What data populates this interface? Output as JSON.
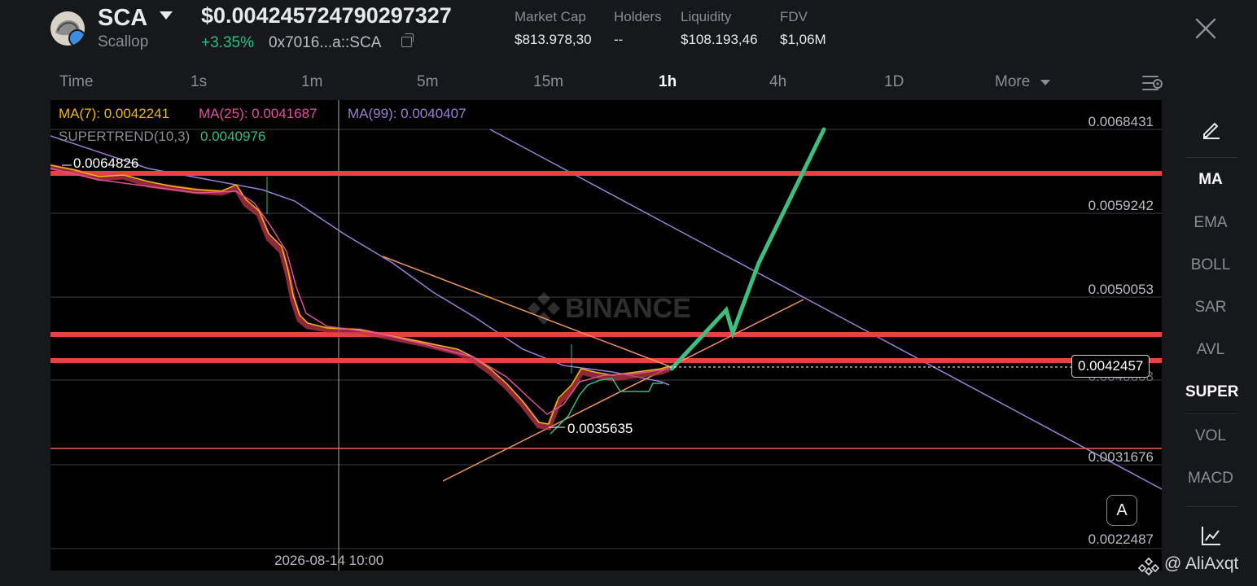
{
  "header": {
    "symbol": "SCA",
    "name": "Scallop",
    "price": "$0.004245724790297327",
    "change": "+3.35%",
    "address": "0x7016...a::SCA",
    "stats": [
      {
        "label": "Market Cap",
        "value": "$813.978,30"
      },
      {
        "label": "Holders",
        "value": "--"
      },
      {
        "label": "Liquidity",
        "value": "$108.193,46"
      },
      {
        "label": "FDV",
        "value": "$1,06M"
      }
    ],
    "close_icon": "close-icon",
    "copy_icon": "copy-icon"
  },
  "intervals": {
    "items": [
      "Time",
      "1s",
      "1m",
      "5m",
      "15m",
      "1h",
      "4h",
      "1D",
      "More"
    ],
    "active": "1h",
    "settings_icon": "chart-settings-icon"
  },
  "chart": {
    "indicators": {
      "ma7": "MA(7): 0.0042241",
      "ma25": "MA(25): 0.0041687",
      "ma99": "MA(99): 0.0040407",
      "supertrend_label": "SUPERTREND(10,3)",
      "supertrend_value": "0.0040976"
    },
    "colors": {
      "ma7": "#f0b90b",
      "ma25": "#e0519a",
      "ma99": "#9b7fd4",
      "supertrend": "#2ebd85",
      "level": "#e84142",
      "arrow": "#3dbf7f",
      "trend": "#f0955a"
    },
    "watermark": "BINANCE",
    "high_label": "0.0064826",
    "low_label": "0.0035635",
    "current_price": "0.0042457",
    "ghost_label": "0.0040603",
    "y_ticks": [
      "0.0068431",
      "0.0059242",
      "0.0050053",
      "0.0031676",
      "0.0022487"
    ],
    "x_label": "2026-08-14 10:00",
    "auto_button": "A"
  },
  "right_panel": {
    "edit_icon": "pencil-icon",
    "items": [
      "MA",
      "EMA",
      "BOLL",
      "SAR",
      "AVL",
      "SUPER",
      "VOL",
      "MACD"
    ],
    "active": [
      "MA",
      "SUPER"
    ],
    "chart_icon": "chart-line-icon"
  },
  "credit": "@ AliAxqt"
}
